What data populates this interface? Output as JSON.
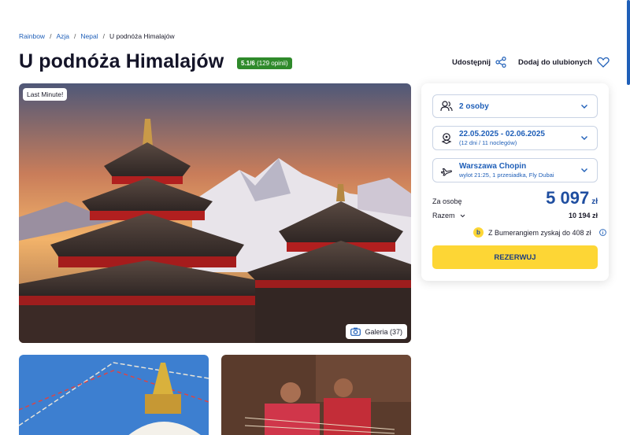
{
  "breadcrumb": [
    "Rainbow",
    "Azja",
    "Nepal",
    "U podnóża Himalajów"
  ],
  "title": "U podnóża Himalajów",
  "rating": {
    "score": "5.1/6",
    "count": "(129 opinii)"
  },
  "actions": {
    "share": "Udostępnij",
    "favorite": "Dodaj do ulubionych"
  },
  "hero": {
    "badge": "Last Minute!",
    "gallery": "Galeria (37)"
  },
  "booking": {
    "persons": "2 osoby",
    "dates": "22.05.2025 - 02.06.2025",
    "dates_sub": "(12 dni / 11 noclegów)",
    "airport": "Warszawa Chopin",
    "flight_sub": "wylot 21:25, 1 przesiadka, Fly Dubai",
    "per_person_label": "Za osobę",
    "per_person_price": "5 097",
    "currency": "zł",
    "total_label": "Razem",
    "total_value": "10 194 zł",
    "bumerang": "Z Bumerangiem zyskaj do 408 zł",
    "bumerang_badge": "b",
    "reserve": "REZERWUJ"
  },
  "colors": {
    "accent": "#1f5fb8",
    "rating": "#2f8a2b",
    "button": "#fdd635"
  },
  "icons": [
    "share-icon",
    "heart-icon",
    "users-icon",
    "calendar-icon",
    "plane-icon",
    "chevron-down-icon",
    "camera-icon",
    "info-icon"
  ]
}
